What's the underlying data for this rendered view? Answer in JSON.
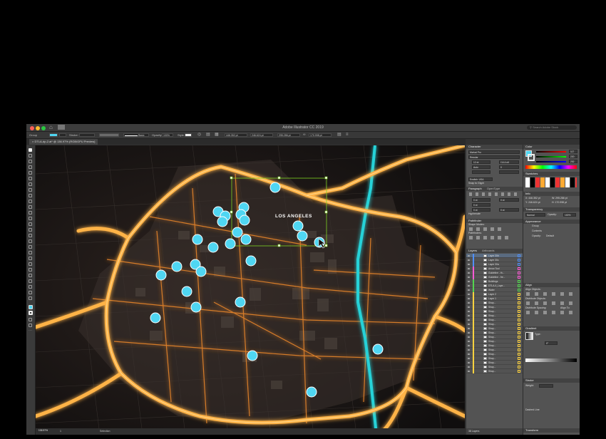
{
  "window": {
    "title": "Adobe Illustrator CC 2019",
    "search_placeholder": "Search Adobe Stock"
  },
  "control_bar": {
    "selection_label": "Group",
    "stroke_label": "Stroke:",
    "brush_label": "Basic",
    "opacity_label": "Opacity:",
    "opacity_value": "100%",
    "style_label": "Style:",
    "x_value": "446.352 pt",
    "y_value": "246.624 pt",
    "w_value": "295.286 pt",
    "h_value": "170.998 pt"
  },
  "document": {
    "tab_label": "DTLA-dp-2.ai* @ 136.97% (RGB/GPU Preview)"
  },
  "map": {
    "label": "LOS ANGELES",
    "marker_color": "#4fd6f2",
    "road_color": "#ffb347",
    "river_color": "#27d2d8",
    "selection_color": "#7ed321"
  },
  "character_panel": {
    "title": "Character",
    "search_label": "Search",
    "font_value": "Myriad Pro",
    "style_value": "Regular",
    "size_value": "12 pt",
    "leading_value": "(14.4 pt)",
    "kerning_value": "Auto",
    "tracking_value": "0",
    "language_value": "English: USA",
    "snap_label": "Snap to Glyph"
  },
  "paragraph_panel": {
    "title": "Paragraph",
    "opentype_label": "OpenType",
    "indent_left": "0 pt",
    "indent_right": "0 pt",
    "indent_first": "0 pt",
    "space_before": "0 pt",
    "space_after": "0 pt",
    "hyphenate_label": "Hyphenate"
  },
  "pathfinder_panel": {
    "title": "Pathfinder",
    "shape_modes_label": "Shape Modes:",
    "pathfinders_label": "Pathfinders:"
  },
  "layers_panel": {
    "title": "Layers",
    "artboards_label": "Artboards",
    "footer": "38 Layers",
    "rows": [
      {
        "name": "Layer 30b",
        "color": "#4f8ff7"
      },
      {
        "name": "Layer 30c",
        "color": "#4f8ff7"
      },
      {
        "name": "Layer 30a",
        "color": "#4f8ff7"
      },
      {
        "name": "Arrow Tool",
        "color": "#ff5ad6"
      },
      {
        "name": "Guideline - th...",
        "color": "#ff5ad6"
      },
      {
        "name": "Guideline - fre...",
        "color": "#ff5ad6"
      },
      {
        "name": "Buildings",
        "color": "#53d64f"
      },
      {
        "name": "DTLA-4_Laye...",
        "color": "#53d64f"
      },
      {
        "name": "Water",
        "color": "#53d64f"
      },
      {
        "name": "Layer 2",
        "color": "#ffd23f"
      },
      {
        "name": "Layer 1",
        "color": "#ffd23f"
      },
      {
        "name": "Shap...",
        "color": "#ffd23f"
      },
      {
        "name": "Shap...",
        "color": "#ffd23f"
      },
      {
        "name": "Shap...",
        "color": "#ffd23f"
      },
      {
        "name": "Shap...",
        "color": "#ffd23f"
      },
      {
        "name": "Shap...",
        "color": "#ffd23f"
      },
      {
        "name": "Shap...",
        "color": "#ffd23f"
      },
      {
        "name": "Shap...",
        "color": "#ffd23f"
      },
      {
        "name": "Shap...",
        "color": "#ffd23f"
      },
      {
        "name": "Shap...",
        "color": "#ffd23f"
      },
      {
        "name": "Shap...",
        "color": "#ffd23f"
      },
      {
        "name": "Shap...",
        "color": "#ffd23f"
      },
      {
        "name": "Shap...",
        "color": "#ffd23f"
      },
      {
        "name": "Shap...",
        "color": "#ffd23f"
      },
      {
        "name": "Shap...",
        "color": "#ffd23f"
      },
      {
        "name": "Shap...",
        "color": "#ffd23f"
      },
      {
        "name": "Shap...",
        "color": "#ffd23f"
      },
      {
        "name": "Shap...",
        "color": "#ffd23f"
      }
    ]
  },
  "color_panel": {
    "title": "Color",
    "r_value": "117",
    "g_value": "220",
    "b_value": "252"
  },
  "swatches_panel": {
    "title": "Swatches"
  },
  "info_panel": {
    "title": "Info",
    "x_value": "X: 446.352 pt",
    "y_value": "Y: 246.624 pt",
    "w_value": "W: 295.286 pt",
    "h_value": "H: 170.998 pt"
  },
  "transparency_panel": {
    "title": "Transparency",
    "mode_value": "Normal",
    "opacity_label": "Opacity:",
    "opacity_value": "100%"
  },
  "appearance_panel": {
    "title": "Appearance",
    "group_label": "Group",
    "contents_label": "Contents",
    "opacity_label": "Opacity:",
    "opacity_value": "Default"
  },
  "align_panel": {
    "title": "Align",
    "align_objects_label": "Align Objects:",
    "distribute_objects_label": "Distribute Objects:",
    "distribute_spacing_label": "Distribute Spacing:",
    "align_to_label": "Align To:"
  },
  "gradient_panel": {
    "title": "Gradient",
    "type_label": "Type:",
    "angle_value": "0°"
  },
  "stroke_panel": {
    "title": "Stroke",
    "weight_label": "Weight:",
    "dashed_label": "Dashed Line"
  },
  "transform_panel": {
    "title": "Transform"
  },
  "status_bar": {
    "zoom_value": "136.97%",
    "artboard_value": "1",
    "tool_label": "Selection"
  }
}
